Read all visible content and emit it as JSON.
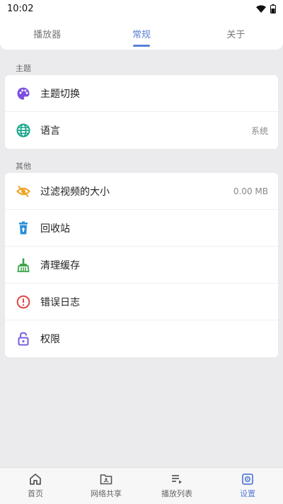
{
  "status_bar": {
    "time": "10:02"
  },
  "tabs": [
    {
      "label": "播放器",
      "active": false
    },
    {
      "label": "常规",
      "active": true
    },
    {
      "label": "关于",
      "active": false
    }
  ],
  "sections": {
    "theme": {
      "title": "主题",
      "items": [
        {
          "label": "主题切换",
          "icon": "palette-icon",
          "value": ""
        },
        {
          "label": "语言",
          "icon": "globe-icon",
          "value": "系统"
        }
      ]
    },
    "other": {
      "title": "其他",
      "items": [
        {
          "label": "过滤视频的大小",
          "icon": "eye-off-icon",
          "value": "0.00 MB"
        },
        {
          "label": "回收站",
          "icon": "recycle-bin-icon",
          "value": ""
        },
        {
          "label": "清理缓存",
          "icon": "broom-icon",
          "value": ""
        },
        {
          "label": "错误日志",
          "icon": "alert-circle-icon",
          "value": ""
        },
        {
          "label": "权限",
          "icon": "lock-open-icon",
          "value": ""
        }
      ]
    }
  },
  "bottom_nav": [
    {
      "label": "首页",
      "icon": "home-icon",
      "active": false
    },
    {
      "label": "网络共享",
      "icon": "network-folder-icon",
      "active": false
    },
    {
      "label": "播放列表",
      "icon": "playlist-icon",
      "active": false
    },
    {
      "label": "设置",
      "icon": "settings-icon",
      "active": true
    }
  ],
  "colors": {
    "accent": "#5b7fd6",
    "palette_icon": "#7b4fe0",
    "globe_icon": "#17a589",
    "eye_off_icon": "#f0a020",
    "recycle_icon": "#2a8fd8",
    "broom_icon": "#3aa34a",
    "alert_icon": "#e04848",
    "lock_icon": "#7b5fe0"
  }
}
